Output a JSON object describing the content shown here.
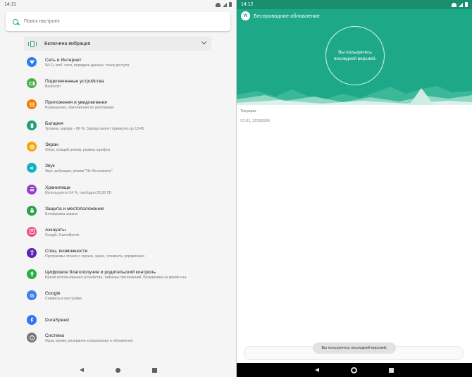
{
  "left": {
    "status": {
      "time": "14:11"
    },
    "search": {
      "placeholder": "Поиск настроек"
    },
    "vibration_row": {
      "label": "Включена вибрация"
    },
    "items": [
      {
        "title": "Сеть и Интернет",
        "subtitle": "Wi-Fi, моб. сети, передача данных, точка доступа",
        "icon": "network-icon",
        "color": "#2e7ef0"
      },
      {
        "title": "Подключенные устройства",
        "subtitle": "Bluetooth",
        "icon": "devices-icon",
        "color": "#4caf50"
      },
      {
        "title": "Приложения и уведомления",
        "subtitle": "Разрешения, приложения по умолчанию",
        "icon": "apps-icon",
        "color": "#f57c00"
      },
      {
        "title": "Батарея",
        "subtitle": "Уровень заряда – 86 %. Заряда хватит примерно до 13:45.",
        "icon": "battery-icon",
        "color": "#1e9e7e"
      },
      {
        "title": "Экран",
        "subtitle": "Обои, спящий режим, размер шрифта",
        "icon": "display-icon",
        "color": "#f5a500"
      },
      {
        "title": "Звук",
        "subtitle": "Звук, вибрация, режим \"Не беспокоить\"",
        "icon": "sound-icon",
        "color": "#13b3c2"
      },
      {
        "title": "Хранилище",
        "subtitle": "Используется 54 %, свободно 29,36 ГБ",
        "icon": "storage-icon",
        "color": "#8e44c9"
      },
      {
        "title": "Защита и местоположение",
        "subtitle": "Блокировка экрана",
        "icon": "security-icon",
        "color": "#24a047"
      },
      {
        "title": "Аккаунты",
        "subtitle": "Google, GameBench",
        "icon": "accounts-icon",
        "color": "#ec4f86"
      },
      {
        "title": "Спец. возможности",
        "subtitle": "Программы чтения с экрана, экран, элементы управления",
        "icon": "accessibility-icon",
        "color": "#5b24b7"
      },
      {
        "title": "Цифровое благополучие и родительский контроль",
        "subtitle": "Время использования устройства, таймеры приложений, блокировка на время сна",
        "icon": "wellbeing-icon",
        "color": "#25b04a"
      },
      {
        "title": "Google",
        "subtitle": "Сервисы и настройки",
        "icon": "google-icon",
        "color": "#3d7ff2"
      },
      {
        "title": "DuraSpeed",
        "subtitle": "",
        "icon": "duraspeed-icon",
        "color": "#2f78ee"
      },
      {
        "title": "Система",
        "subtitle": "Язык, время, резервное копирование и обновления",
        "icon": "system-icon",
        "color": "#757575"
      }
    ]
  },
  "right": {
    "status": {
      "time": "14:12"
    },
    "header": {
      "title": "Беспроводное обновление",
      "circle_text": "Вы пользуетесь последней версией."
    },
    "current_label": "Текущая:",
    "version": "V1.01_20190906",
    "toast": "Вы пользуетесь последней версией."
  },
  "colors": {
    "accent": "#1da987",
    "status_bar_right": "#1a8f70"
  }
}
